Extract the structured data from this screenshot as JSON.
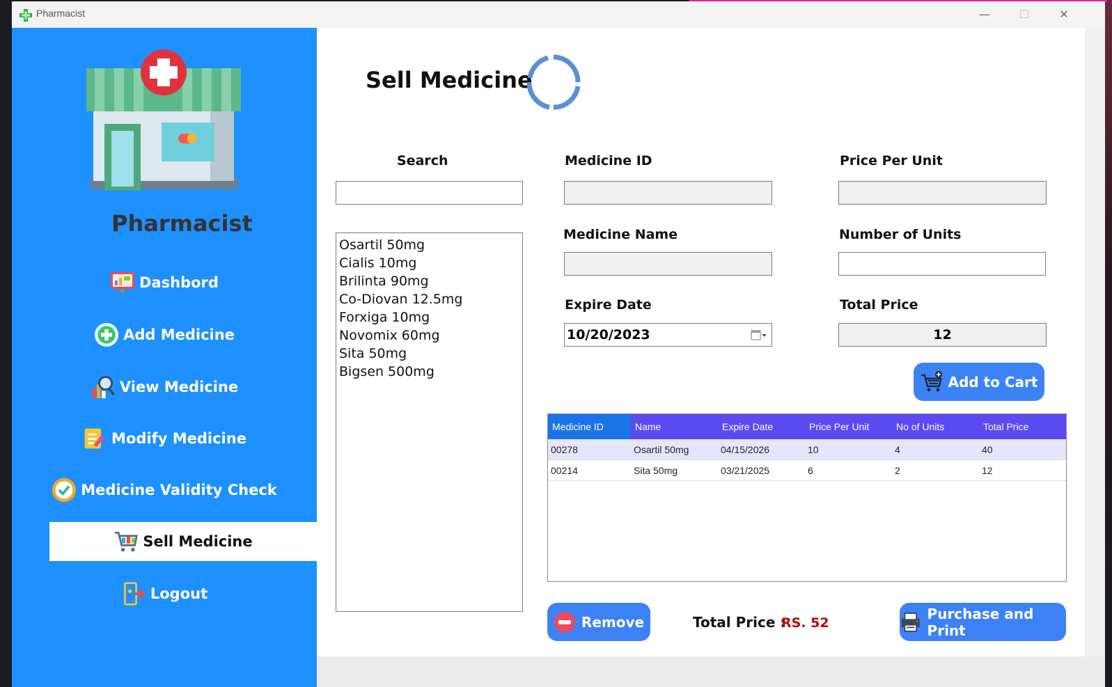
{
  "window": {
    "title": "Pharmacist",
    "minimize": "—",
    "maximize": "☐",
    "close": "✕"
  },
  "sidebar": {
    "brand": "Pharmacist",
    "items": [
      {
        "label": "Dashbord",
        "icon": "dashboard-icon"
      },
      {
        "label": "Add Medicine",
        "icon": "add-circle-icon"
      },
      {
        "label": "View Medicine",
        "icon": "magnifier-chart-icon"
      },
      {
        "label": "Modify Medicine",
        "icon": "edit-note-icon"
      },
      {
        "label": "Medicine Validity Check",
        "icon": "check-badge-icon"
      },
      {
        "label": "Sell Medicine",
        "icon": "shopping-cart-icon",
        "active": true
      },
      {
        "label": "Logout",
        "icon": "logout-icon"
      }
    ]
  },
  "main": {
    "title": "Sell Medicine",
    "search_label": "Search",
    "search_value": "",
    "medicine_list": [
      "Osartil 50mg",
      "Cialis 10mg",
      "Brilinta 90mg",
      "Co-Diovan 12.5mg",
      "Forxiga 10mg",
      "Novomix 60mg",
      "Sita 50mg",
      "Bigsen 500mg"
    ],
    "medicine_id_label": "Medicine ID",
    "medicine_id_value": "",
    "price_per_unit_label": "Price Per Unit",
    "price_per_unit_value": "",
    "medicine_name_label": "Medicine Name",
    "medicine_name_value": "",
    "number_of_units_label": "Number of Units",
    "number_of_units_value": "",
    "expire_date_label": "Expire Date",
    "expire_date_value": "10/20/2023",
    "total_price_label": "Total Price",
    "total_price_value": "12",
    "add_to_cart": "Add to Cart",
    "remove": "Remove",
    "total_price_footer_label": "Total Price :",
    "total_price_footer_value": "RS. 52",
    "purchase_print": "Purchase and Print"
  },
  "cart": {
    "columns": [
      "Medicine ID",
      "Name",
      "Expire Date",
      "Price Per Unit",
      "No of Units",
      "Total Price"
    ],
    "rows": [
      [
        "00278",
        "Osartil 50mg",
        "04/15/2026",
        "10",
        "4",
        "40"
      ],
      [
        "00214",
        "Sita 50mg",
        "03/21/2025",
        "6",
        "2",
        "12"
      ]
    ]
  },
  "colors": {
    "sidebar": "#1e90ff",
    "header": "#5b4af0",
    "button": "#3d82f5",
    "total": "#c00000"
  }
}
